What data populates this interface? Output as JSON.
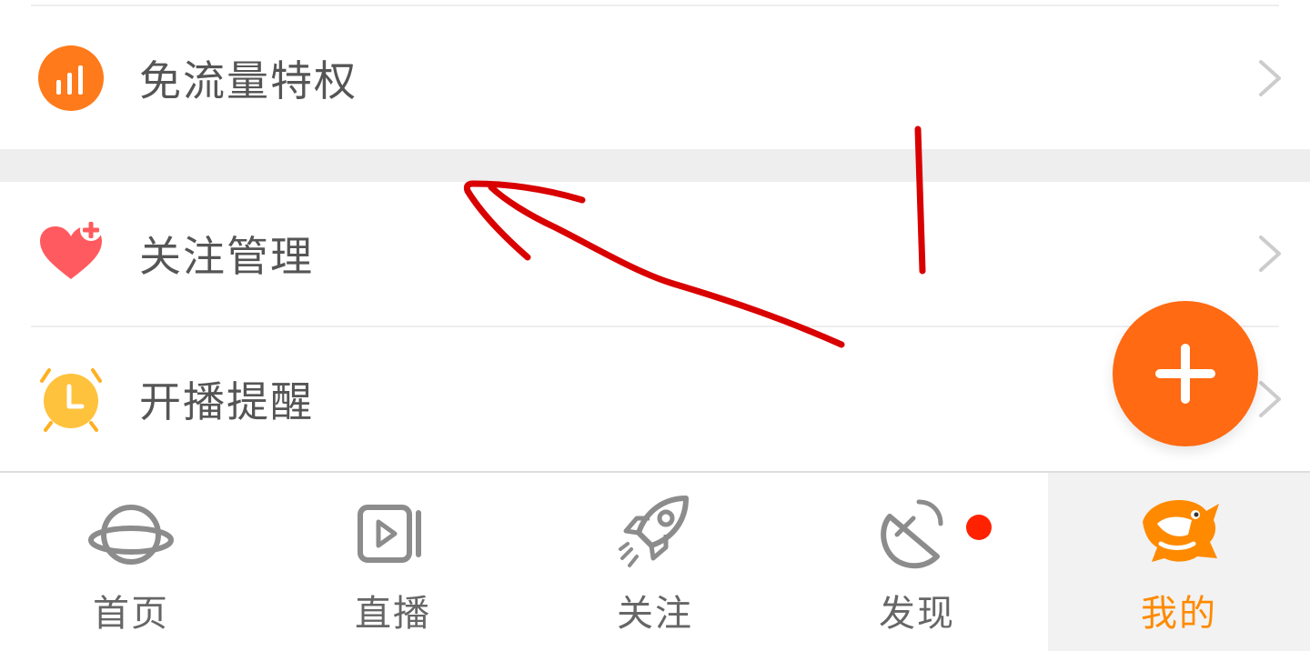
{
  "menu": {
    "items": [
      {
        "label": "免流量特权",
        "icon": "data-bars-icon"
      },
      {
        "label": "关注管理",
        "icon": "heart-plus-icon"
      },
      {
        "label": "开播提醒",
        "icon": "alarm-clock-icon"
      }
    ]
  },
  "fab": {
    "icon": "plus-icon"
  },
  "tabbar": {
    "tabs": [
      {
        "label": "首页",
        "icon": "planet-icon",
        "active": false
      },
      {
        "label": "直播",
        "icon": "play-video-icon",
        "active": false
      },
      {
        "label": "关注",
        "icon": "rocket-icon",
        "active": false
      },
      {
        "label": "发现",
        "icon": "satellite-dish-icon",
        "active": false,
        "badge": "dot"
      },
      {
        "label": "我的",
        "icon": "mascot-icon",
        "active": true
      }
    ]
  },
  "colors": {
    "accent": "#ff6a12",
    "active_tab_text": "#ff8a00",
    "badge": "#ff2200",
    "annotation": "#d90000"
  }
}
